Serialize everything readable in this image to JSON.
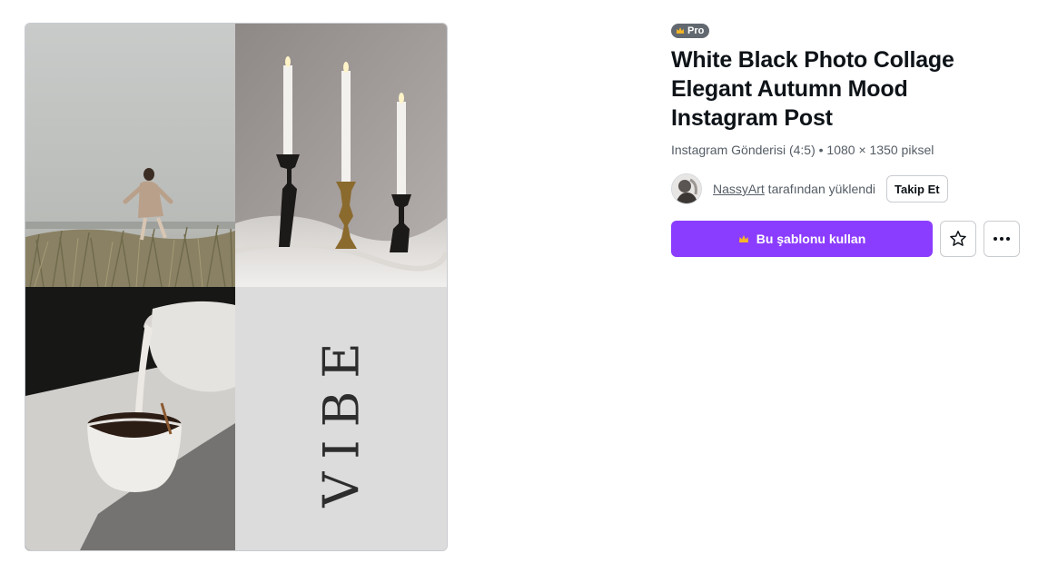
{
  "template": {
    "badge": "Pro",
    "title_lines": [
      "White Black Photo Collage",
      "Elegant Autumn Mood",
      "Instagram Post"
    ],
    "meta": "Instagram Gönderisi (4:5) • 1080 × 1350 piksel",
    "author_name": "NassyArt",
    "author_suffix": " tarafından yüklendi",
    "follow_label": "Takip Et",
    "use_label": "Bu şablonu kullan",
    "preview_text": "VIBE"
  },
  "icons": {
    "crown": "crown-icon",
    "star": "star-icon",
    "more": "more-horizontal-icon"
  },
  "colors": {
    "accent": "#8b3dff",
    "badge_bg": "#62686f",
    "crown_gold": "#f6b626"
  }
}
